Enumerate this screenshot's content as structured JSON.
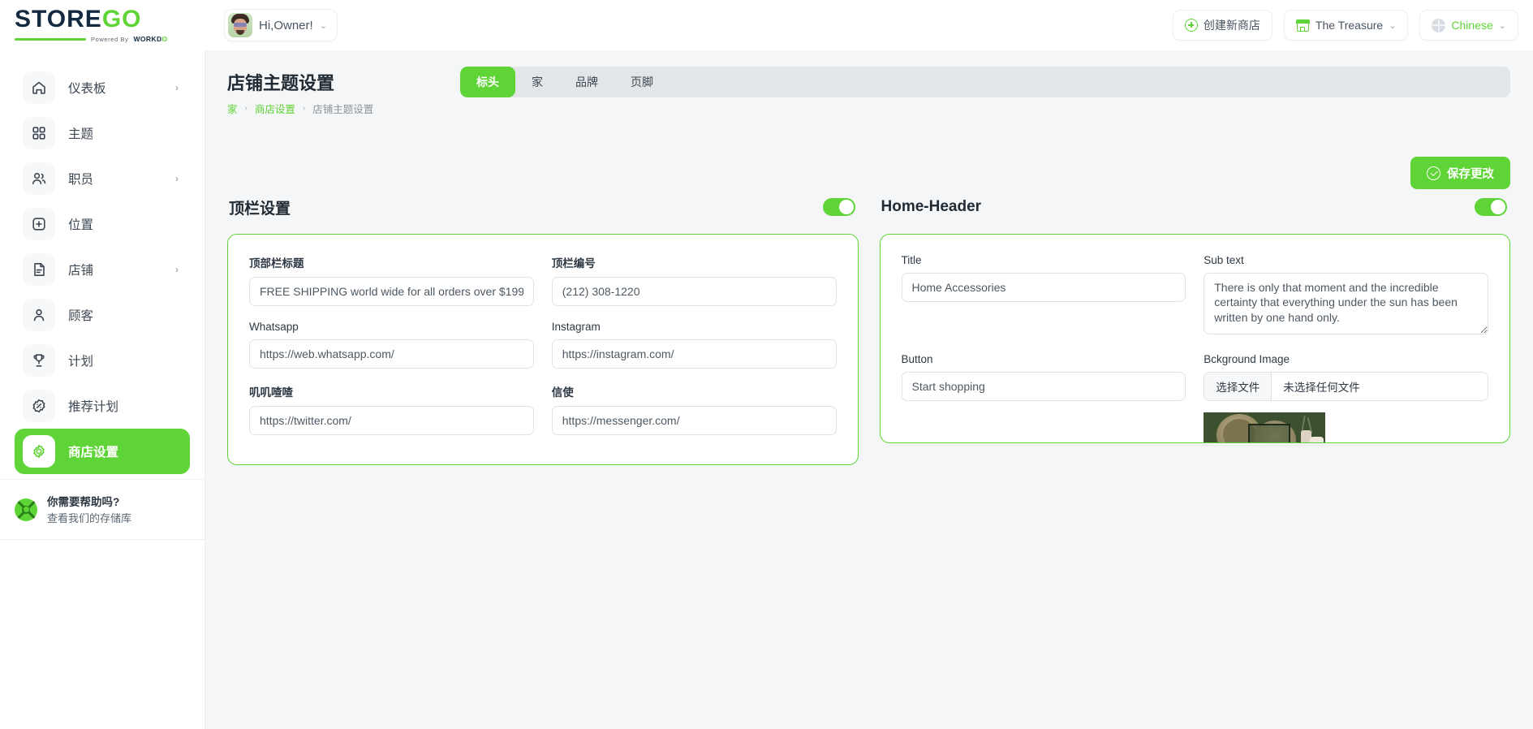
{
  "brand": {
    "logo_main_dark": "STORE",
    "logo_main_green": "GO",
    "logo_powered": "Powered By",
    "logo_workdo_a": "WORKD",
    "logo_workdo_b": "O"
  },
  "topbar": {
    "user_greeting": "Hi,Owner!",
    "create_store_label": "创建新商店",
    "store_name": "The Treasure",
    "language": "Chinese",
    "caret": "⌄"
  },
  "sidebar": {
    "items": [
      {
        "label": "仪表板",
        "icon": "home-icon",
        "arrow": "›",
        "has_arrow": true,
        "active": false
      },
      {
        "label": "主题",
        "icon": "grid-icon",
        "arrow": "",
        "has_arrow": false,
        "active": false
      },
      {
        "label": "职员",
        "icon": "users-icon",
        "arrow": "›",
        "has_arrow": true,
        "active": false
      },
      {
        "label": "位置",
        "icon": "location-icon",
        "arrow": "",
        "has_arrow": false,
        "active": false
      },
      {
        "label": "店铺",
        "icon": "store-icon",
        "arrow": "›",
        "has_arrow": true,
        "active": false
      },
      {
        "label": "顾客",
        "icon": "user-icon",
        "arrow": "",
        "has_arrow": false,
        "active": false
      },
      {
        "label": "计划",
        "icon": "trophy-icon",
        "arrow": "",
        "has_arrow": false,
        "active": false
      },
      {
        "label": "推荐计划",
        "icon": "badge-percent-icon",
        "arrow": "",
        "has_arrow": false,
        "active": false
      },
      {
        "label": "商店设置",
        "icon": "gear-icon",
        "arrow": "",
        "has_arrow": false,
        "active": true
      }
    ],
    "help": {
      "title": "你需要帮助吗?",
      "subtitle": "查看我们的存储库"
    }
  },
  "page": {
    "title": "店铺主题设置",
    "breadcrumb": [
      {
        "label": "家",
        "current": false
      },
      {
        "label": "商店设置",
        "current": false
      },
      {
        "label": "店铺主题设置",
        "current": true
      }
    ],
    "breadcrumb_sep": "›",
    "tabs": [
      {
        "label": "标头",
        "active": true
      },
      {
        "label": "家",
        "active": false
      },
      {
        "label": "品牌",
        "active": false
      },
      {
        "label": "页脚",
        "active": false
      }
    ],
    "save_label": "保存更改"
  },
  "topbar_settings": {
    "title": "顶栏设置",
    "enabled": true,
    "fields": {
      "top_title_label": "顶部栏标题",
      "top_title_value": "FREE SHIPPING world wide for all orders over $199",
      "top_number_label": "顶栏编号",
      "top_number_value": "(212) 308-1220",
      "whatsapp_label": "Whatsapp",
      "whatsapp_value": "https://web.whatsapp.com/",
      "instagram_label": "Instagram",
      "instagram_value": "https://instagram.com/",
      "twitter_label": "叽叽喳喳",
      "twitter_value": "https://twitter.com/",
      "messenger_label": "信使",
      "messenger_value": "https://messenger.com/"
    }
  },
  "home_header": {
    "title": "Home-Header",
    "enabled": true,
    "fields": {
      "title_label": "Title",
      "title_value": "Home Accessories",
      "subtext_label": "Sub text",
      "subtext_value": "There is only that moment and the incredible certainty that everything under the sun has been written by one hand only.",
      "button_label": "Button",
      "button_value": "Start shopping",
      "bg_image_label": "Bckground Image",
      "file_choose_label": "选择文件",
      "file_status_label": "未选择任何文件"
    }
  },
  "colors": {
    "accent_green": "#5fd436",
    "page_bg": "#f5f6f7",
    "card_border": "#5fd436",
    "text_dark": "#1f2a33"
  }
}
